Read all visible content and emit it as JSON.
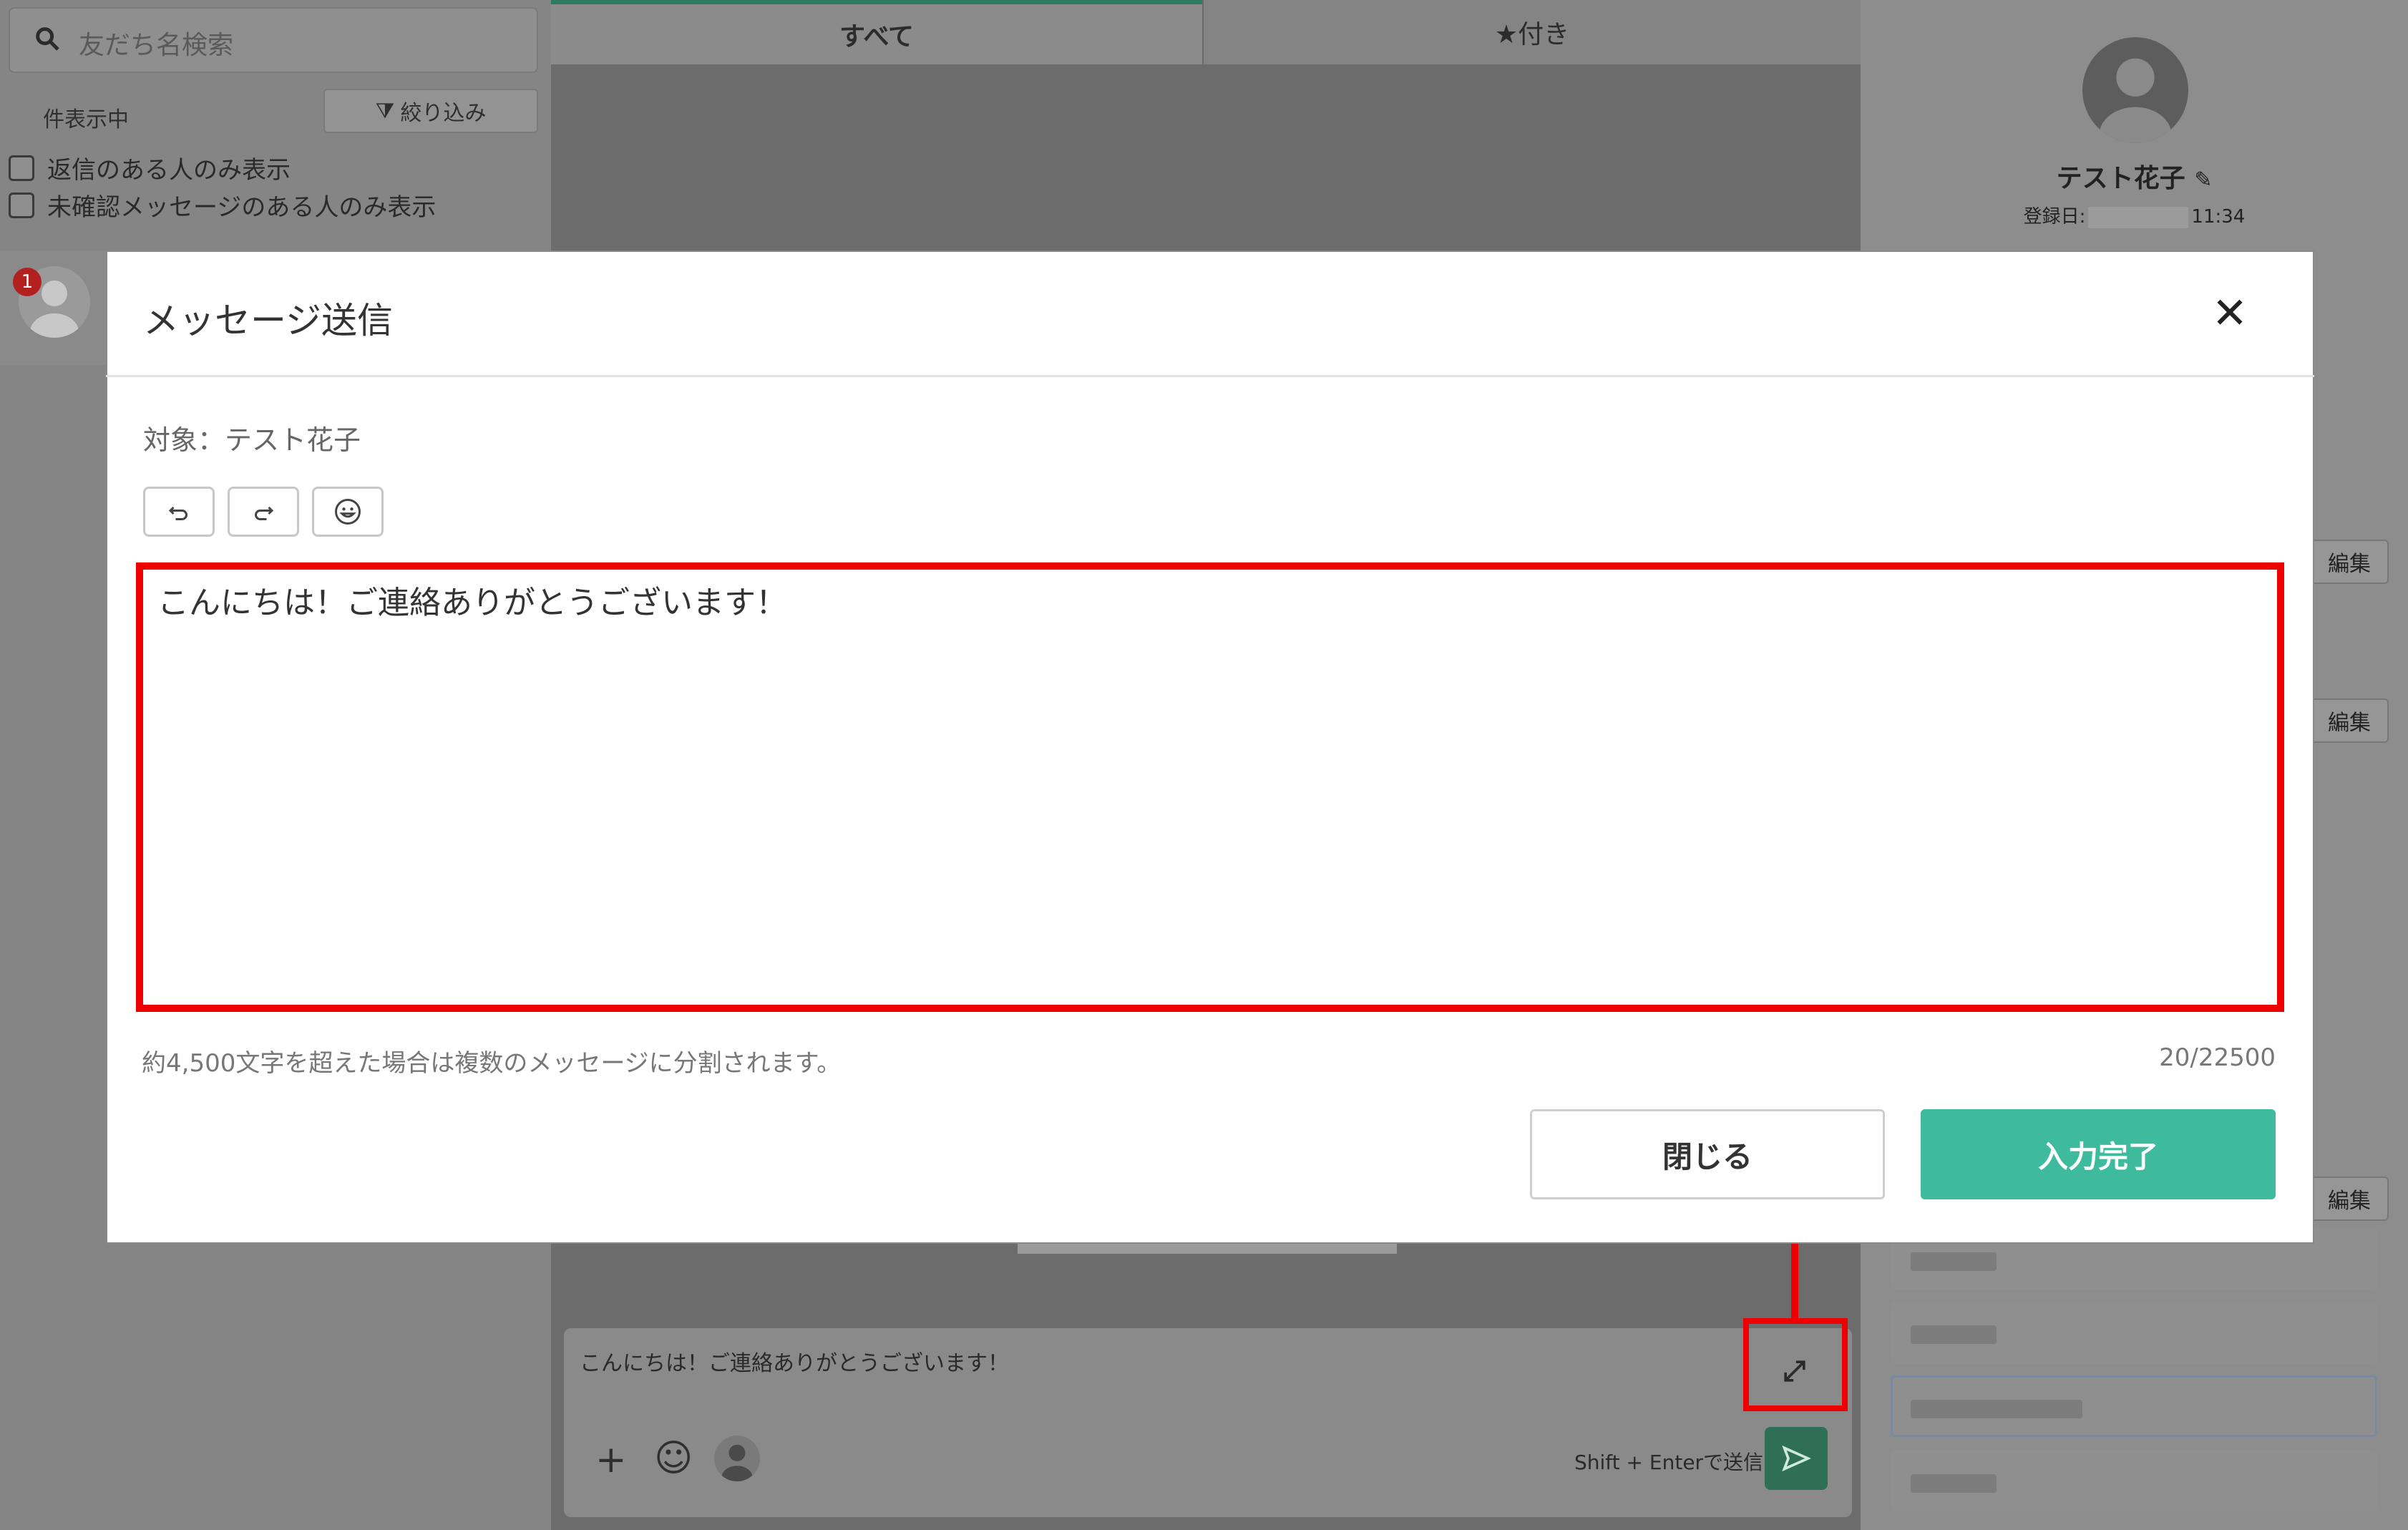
{
  "left_panel": {
    "search_placeholder": "友だち名検索",
    "count_label": "件表示中",
    "filter_label": "絞り込み",
    "checkbox_reply_only": "返信のある人のみ表示",
    "checkbox_unread_only": "未確認メッセージのある人のみ表示",
    "friend_badge": "1"
  },
  "center_tabs": {
    "all": "すべて",
    "starred": "★付き"
  },
  "profile": {
    "name": "テスト花子",
    "registered_label": "登録日:",
    "registered_time": "11:34",
    "edit_label": "編集"
  },
  "composer": {
    "text": "こんにちは！ご連絡ありがとうございます！",
    "shift_hint": "Shift + Enterで送信"
  },
  "modal": {
    "title": "メッセージ送信",
    "target": "対象：テスト花子",
    "message": "こんにちは！ご連絡ありがとうございます！",
    "split_hint": "約4,500文字を超えた場合は複数のメッセージに分割されます。",
    "counter": "20/22500",
    "close_button": "閉じる",
    "done_button": "入力完了"
  },
  "colors": {
    "accent_green": "#3dbb9c",
    "highlight_red": "#ee0000"
  }
}
